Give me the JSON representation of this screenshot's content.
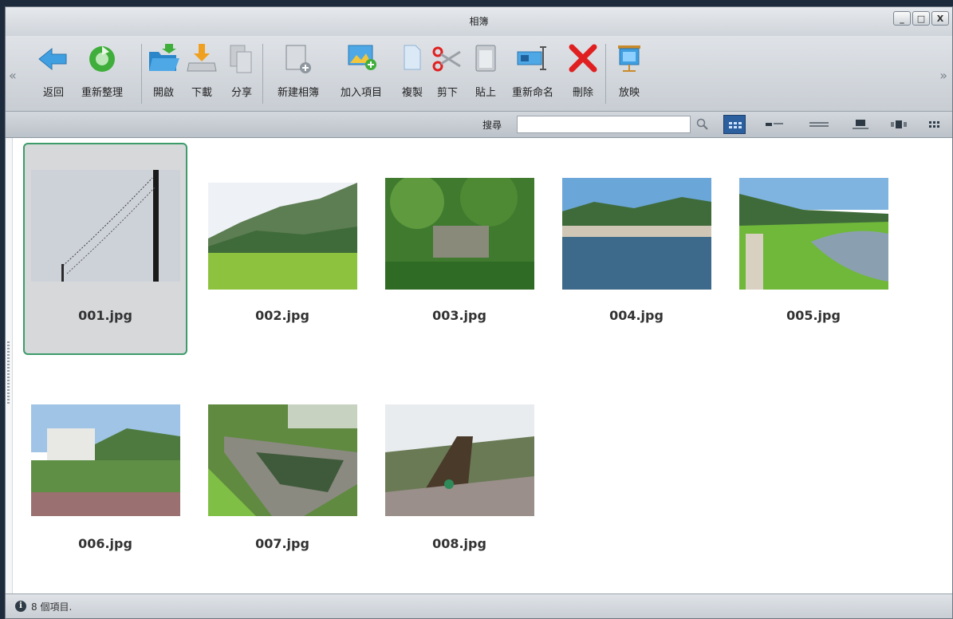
{
  "window": {
    "title": "相簿",
    "controls": {
      "minimize": "_",
      "maximize": "□",
      "close": "X"
    }
  },
  "toolbar": {
    "scroll_left": "«",
    "scroll_right": "»",
    "buttons": [
      {
        "label": "返回",
        "icon": "back-arrow-icon"
      },
      {
        "label": "重新整理",
        "icon": "refresh-icon"
      },
      {
        "label": "開啟",
        "icon": "open-folder-icon"
      },
      {
        "label": "下載",
        "icon": "download-icon"
      },
      {
        "label": "分享",
        "icon": "share-icon"
      },
      {
        "label": "新建相簿",
        "icon": "new-album-icon"
      },
      {
        "label": "加入項目",
        "icon": "add-item-icon"
      },
      {
        "label": "複製",
        "icon": "copy-icon"
      },
      {
        "label": "剪下",
        "icon": "cut-icon"
      },
      {
        "label": "貼上",
        "icon": "paste-icon"
      },
      {
        "label": "重新命名",
        "icon": "rename-icon"
      },
      {
        "label": "刪除",
        "icon": "delete-icon"
      },
      {
        "label": "放映",
        "icon": "slideshow-icon"
      }
    ]
  },
  "search": {
    "label": "搜尋",
    "value": "",
    "placeholder": ""
  },
  "items": [
    {
      "name": "001.jpg",
      "selected": true
    },
    {
      "name": "002.jpg",
      "selected": false
    },
    {
      "name": "003.jpg",
      "selected": false
    },
    {
      "name": "004.jpg",
      "selected": false
    },
    {
      "name": "005.jpg",
      "selected": false
    },
    {
      "name": "006.jpg",
      "selected": false
    },
    {
      "name": "007.jpg",
      "selected": false
    },
    {
      "name": "008.jpg",
      "selected": false
    }
  ],
  "status": {
    "text": "8 個項目."
  },
  "colors": {
    "selection_border": "#3d9c6a",
    "active_view": "#2b5f9e",
    "delete_red": "#e02020",
    "refresh_green": "#3fae3a",
    "back_blue": "#3f9fe0"
  }
}
